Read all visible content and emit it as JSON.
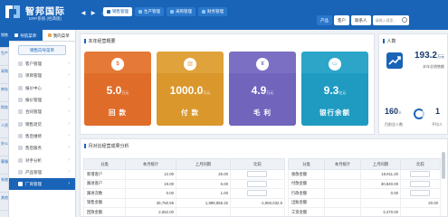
{
  "app": {
    "title": "智邦国际",
    "subtitle": "ERP系统 (经典版)"
  },
  "nav": {
    "tabs": [
      {
        "label": "销售管理"
      },
      {
        "label": "生产管理"
      },
      {
        "label": "采购管理"
      },
      {
        "label": "财务管理"
      }
    ]
  },
  "topright": {
    "links": [
      "",
      "",
      "",
      ""
    ],
    "buttons": [
      {
        "label": "产品"
      },
      {
        "label": "客户"
      },
      {
        "label": "联系人"
      }
    ],
    "search_placeholder": "请输入搜索..."
  },
  "leftstrip": {
    "items": [
      "销售",
      "生产",
      "采购",
      "库存",
      "财务",
      "人资",
      "办公",
      "客服",
      "系统",
      "其他"
    ]
  },
  "sidebar": {
    "tabs": [
      {
        "label": "导航菜单"
      },
      {
        "label": "我的菜单"
      }
    ],
    "top_button": "销售向导菜单",
    "items": [
      {
        "label": "客户管理"
      },
      {
        "label": "项目管理"
      },
      {
        "label": "报价中心"
      },
      {
        "label": "报价管理"
      },
      {
        "label": "合同管理"
      },
      {
        "label": "销售退货"
      },
      {
        "label": "售后维修"
      },
      {
        "label": "售后服务"
      },
      {
        "label": "对手分析"
      },
      {
        "label": "产品管理"
      },
      {
        "label": "厂商管理"
      }
    ]
  },
  "overview": {
    "title": "本年经营概要",
    "cards": [
      {
        "icon": "money-icon",
        "value": "5.0",
        "unit": "万元",
        "label": "回 款",
        "color": "#e57a38",
        "band": "#e06c2a"
      },
      {
        "icon": "chart-icon",
        "value": "1000.0",
        "unit": "万元",
        "label": "付 款",
        "color": "#e0a23a",
        "band": "#d9972c"
      },
      {
        "icon": "yen-icon",
        "value": "4.9",
        "unit": "万元",
        "label": "毛 利",
        "color": "#7b6fc4",
        "band": "#7064bd"
      },
      {
        "icon": "wallet-icon",
        "value": "9.3",
        "unit": "亿元",
        "label": "银行余额",
        "color": "#2ca5c9",
        "band": "#1f9bc1"
      }
    ]
  },
  "stats": {
    "title": "人数",
    "big_value": "193.2",
    "big_unit": "万元",
    "big_caption": "本年总销售额",
    "left_value": "160",
    "left_unit": "人",
    "left_caption": "目前总人数",
    "right_value": "1",
    "right_caption": "平均人",
    "colors": {
      "accent": "#1a64b8"
    }
  },
  "compare": {
    "title": "月对比经营成果分析",
    "left_table": {
      "headers": [
        "分类",
        "本月统计",
        "上月同期",
        "比较"
      ],
      "rows": [
        [
          "新增客户",
          "12.00",
          "26.00",
          ""
        ],
        [
          "跟进客户",
          "19.00",
          "6.00",
          ""
        ],
        [
          "跟进次数",
          "0.00",
          "1.00",
          ""
        ],
        [
          "销售金额",
          "36,750.55",
          "1,888,855.32",
          "-1,850,032.5"
        ],
        [
          "回款金额",
          "2,552.00",
          "",
          ""
        ]
      ]
    },
    "right_table": {
      "headers": [
        "分类",
        "本月统计",
        "上月同期",
        "比较"
      ],
      "rows": [
        [
          "收款金额",
          "",
          "18,911.20",
          ""
        ],
        [
          "付款金额",
          "",
          "30,840.00",
          ""
        ],
        [
          "行政金额",
          "",
          "0.00",
          ""
        ],
        [
          "出账金额",
          "",
          "",
          "20.00"
        ],
        [
          "工资金额",
          "",
          "3,470.00",
          ""
        ]
      ]
    }
  }
}
